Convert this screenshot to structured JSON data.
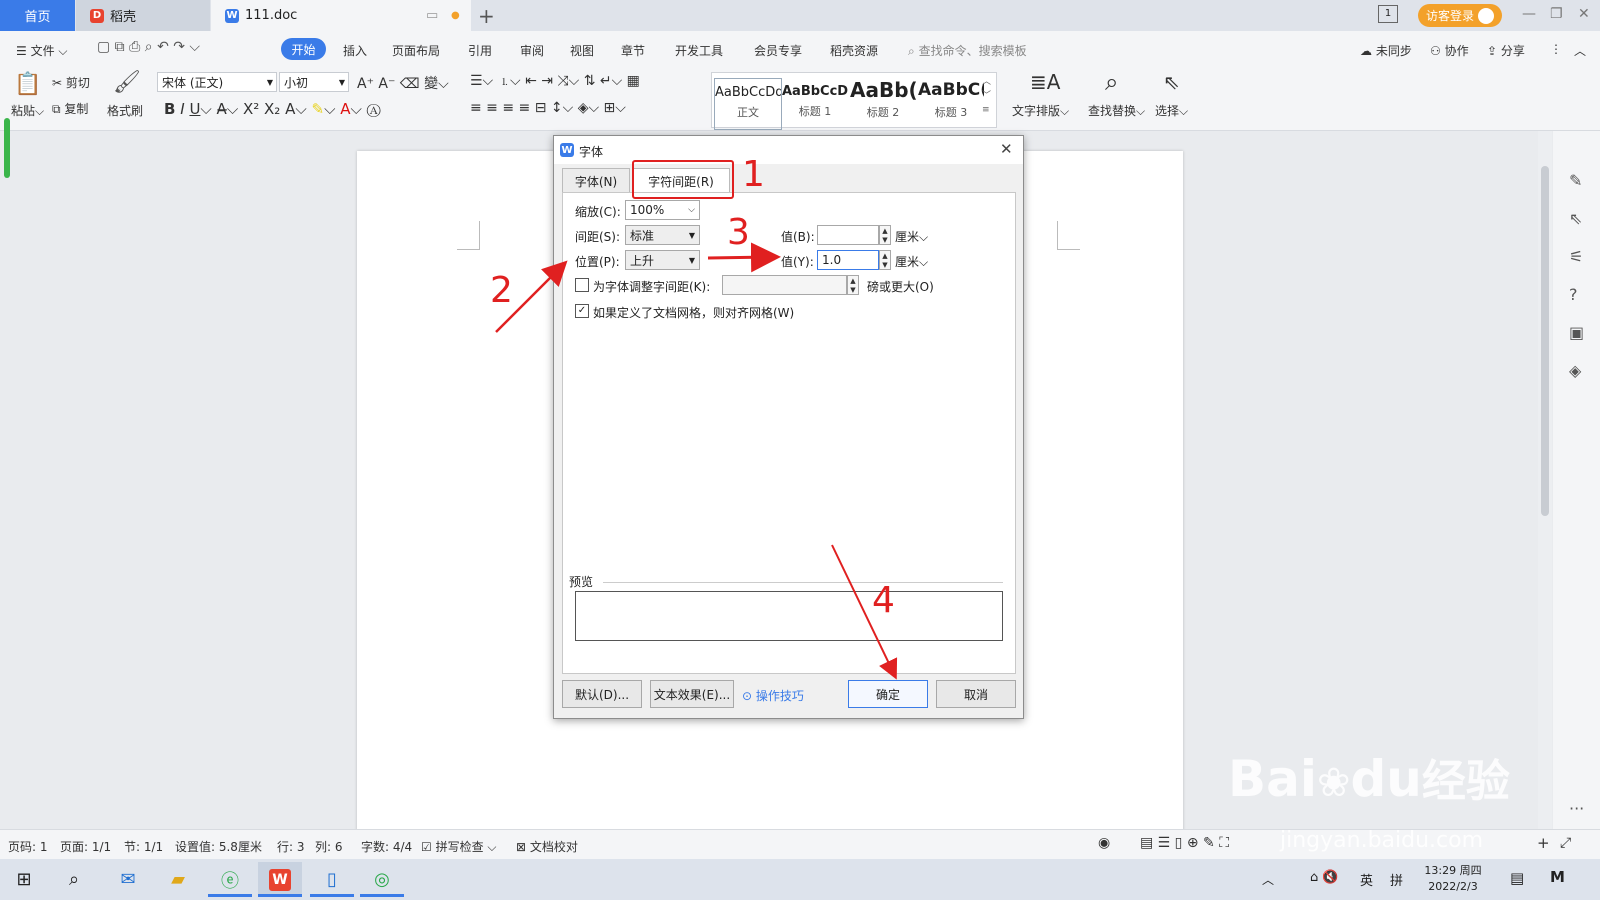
{
  "tabs": {
    "home": "首页",
    "daoke": "稻壳",
    "doc": "111.doc",
    "login": "访客登录"
  },
  "menu": {
    "file": "文件",
    "start": "开始",
    "insert": "插入",
    "layout": "页面布局",
    "ref": "引用",
    "review": "审阅",
    "view": "视图",
    "section": "章节",
    "devtools": "开发工具",
    "member": "会员专享",
    "resources": "稻壳资源",
    "search_placeholder": "查找命令、搜索模板",
    "sync": "未同步",
    "collab": "协作",
    "share": "分享"
  },
  "ribbon": {
    "paste": "粘贴",
    "cut": "剪切",
    "copy": "复制",
    "format_painter": "格式刷",
    "font_name": "宋体 (正文)",
    "font_size": "小初",
    "styles": [
      {
        "preview": "AaBbCcDd",
        "label": "正文"
      },
      {
        "preview": "AaBbCcD",
        "label": "标题 1"
      },
      {
        "preview": "AaBb(",
        "label": "标题 2"
      },
      {
        "preview": "AaBbC(",
        "label": "标题 3"
      }
    ],
    "text_layout": "文字排版",
    "find_replace": "查找替换",
    "select": "选择"
  },
  "dialog": {
    "title": "字体",
    "tab_font": "字体(N)",
    "tab_spacing": "字符间距(R)",
    "scale_label": "缩放(C):",
    "scale_value": "100%",
    "spacing_label": "间距(S):",
    "spacing_value": "标准",
    "spacing_amount_label": "值(B):",
    "spacing_amount_value": "",
    "unit_cm": "厘米",
    "position_label": "位置(P):",
    "position_value": "上升",
    "position_amount_label": "值(Y):",
    "position_amount_value": "1.0",
    "unit_cm2": "厘米",
    "kerning_label": "为字体调整字间距(K):",
    "kerning_value": "",
    "kerning_suffix": "磅或更大(O)",
    "grid_label": "如果定义了文档网格，则对齐网格(W)",
    "preview_label": "预览",
    "btn_default": "默认(D)...",
    "btn_effects": "文本效果(E)...",
    "tips": "操作技巧",
    "btn_ok": "确定",
    "btn_cancel": "取消"
  },
  "annotations": [
    "1",
    "2",
    "3",
    "4"
  ],
  "status": {
    "page": "页码: 1",
    "pages": "页面: 1/1",
    "section": "节: 1/1",
    "setting": "设置值: 5.8厘米",
    "row": "行: 3",
    "col": "列: 6",
    "words": "字数: 4/4",
    "spell": "拼写检查",
    "proof": "文档校对"
  },
  "taskbar": {
    "ime": "英",
    "time": "13:29 周四",
    "date": "2022/2/3"
  },
  "watermark": {
    "brand": "Bai",
    "paw": "du",
    "cn": "经验",
    "url": "jingyan.baidu.com"
  },
  "colors": {
    "accent": "#3a7be8",
    "annotation": "#e02020",
    "login": "#f3a12a"
  }
}
